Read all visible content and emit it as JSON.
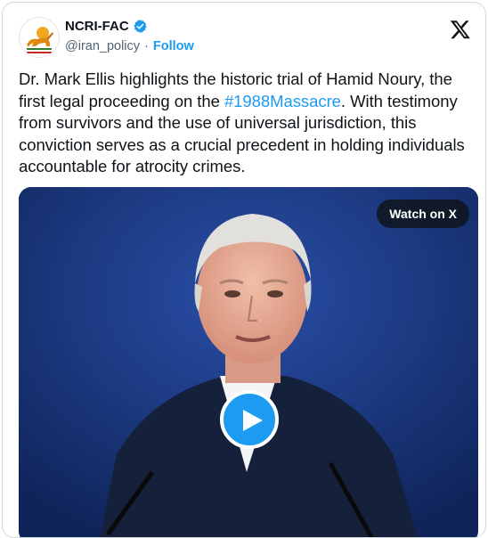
{
  "account": {
    "display_name": "NCRI-FAC",
    "handle": "@iran_policy",
    "separator": "·",
    "follow_label": "Follow"
  },
  "tweet": {
    "text_part1": "Dr. Mark Ellis highlights the historic trial of Hamid Noury, the first legal proceeding on the ",
    "hashtag": "#1988Massacre",
    "text_part2": ". With testimony from survivors and the use of universal jurisdiction, this conviction serves as a crucial precedent in holding individuals accountable for atrocity crimes."
  },
  "media": {
    "watch_label": "Watch on X"
  },
  "icons": {
    "verified": "verified-badge-icon",
    "x_logo": "x-logo-icon",
    "play": "play-icon"
  },
  "colors": {
    "accent": "#1d9bf0",
    "text": "#0f1419",
    "muted": "#536471",
    "video_background": "#17326e"
  }
}
